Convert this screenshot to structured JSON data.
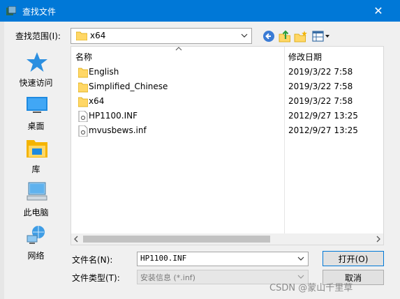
{
  "window": {
    "title": "查找文件",
    "close_glyph": "✕"
  },
  "toolbar": {
    "lookin_label": "查找范围(I):",
    "current_folder": "x64"
  },
  "places": [
    {
      "id": "quick-access",
      "label": "快速访问",
      "icon": "star-icon"
    },
    {
      "id": "desktop",
      "label": "桌面",
      "icon": "desktop-icon"
    },
    {
      "id": "libraries",
      "label": "库",
      "icon": "library-icon"
    },
    {
      "id": "this-pc",
      "label": "此电脑",
      "icon": "computer-icon"
    },
    {
      "id": "network",
      "label": "网络",
      "icon": "network-icon"
    }
  ],
  "filelist": {
    "columns": {
      "name": "名称",
      "date": "修改日期"
    },
    "rows": [
      {
        "name": "English",
        "date": "2019/3/22 7:58",
        "type": "folder"
      },
      {
        "name": "Simplified_Chinese",
        "date": "2019/3/22 7:58",
        "type": "folder"
      },
      {
        "name": "x64",
        "date": "2019/3/22 7:58",
        "type": "folder"
      },
      {
        "name": "HP1100.INF",
        "date": "2012/9/27 13:25",
        "type": "file"
      },
      {
        "name": "mvusbews.inf",
        "date": "2012/9/27 13:25",
        "type": "file"
      }
    ]
  },
  "bottom": {
    "filename_label": "文件名(N):",
    "filename_value": "HP1100.INF",
    "filetype_label": "文件类型(T):",
    "filetype_value": "安装信息 (*.inf)",
    "open_label": "打开(O)",
    "cancel_label": "取消"
  },
  "watermark": "CSDN @蒙山千里草",
  "colors": {
    "titlebar": "#0078d7",
    "folder": "#ffd766",
    "accent": "#0078d7"
  }
}
